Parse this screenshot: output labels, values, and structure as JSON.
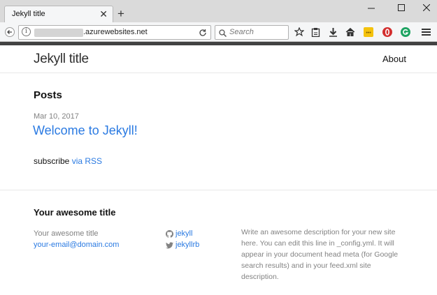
{
  "browser": {
    "tab_title": "Jekyll title",
    "tab_close": "✕",
    "new_tab": "+",
    "url": ".azurewebsites.net",
    "search_placeholder": "Search"
  },
  "icons": {
    "back": "back-arrow-icon",
    "info": "info-icon",
    "reload": "reload-icon",
    "search": "search-icon",
    "bookmark": "star-icon",
    "reader": "clipboard-icon",
    "download": "download-icon",
    "home": "home-icon",
    "ext_yellow": "extension-yellow-icon",
    "ext_red": "extension-red-icon",
    "ext_green": "extension-green-icon",
    "menu": "hamburger-menu-icon"
  },
  "colors": {
    "link": "#2a7ae2",
    "muted": "#828282",
    "ext_yellow": "#f4c20d",
    "ext_red": "#d32f2f",
    "ext_green": "#1ea362"
  },
  "site": {
    "title": "Jekyll title",
    "nav": {
      "about": "About"
    }
  },
  "main": {
    "posts_heading": "Posts",
    "posts": [
      {
        "date": "Mar 10, 2017",
        "title": "Welcome to Jekyll!"
      }
    ],
    "subscribe_prefix": "subscribe",
    "subscribe_link": "via RSS"
  },
  "footer": {
    "heading": "Your awesome title",
    "name": "Your awesome title",
    "email": "your-email@domain.com",
    "github": "jekyll",
    "twitter": "jekyllrb",
    "description": "Write an awesome description for your new site here. You can edit this line in _config.yml. It will appear in your document head meta (for Google search results) and in your feed.xml site description."
  }
}
